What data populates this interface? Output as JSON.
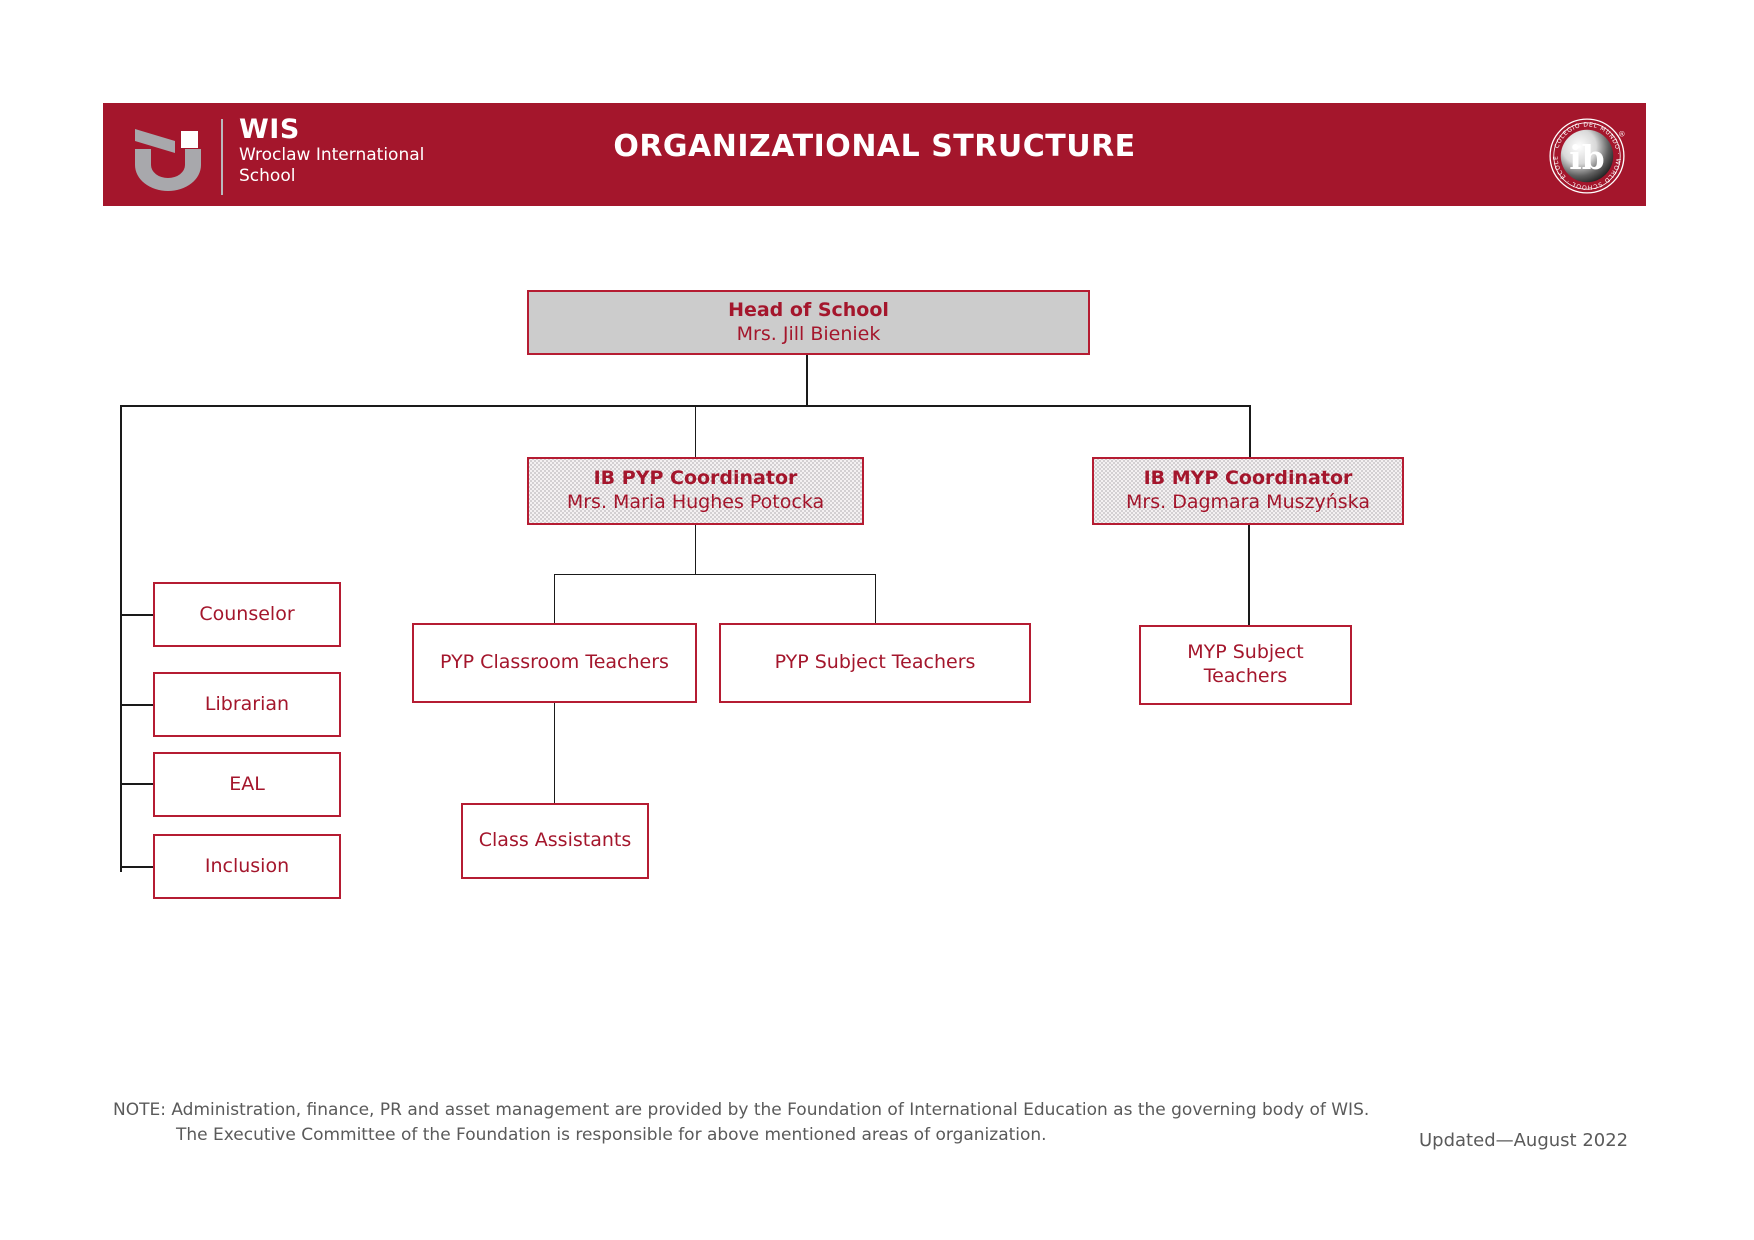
{
  "header": {
    "title": "ORGANIZATIONAL STRUCTURE",
    "brand_abbr": "WIS",
    "brand_line1": "Wroclaw International",
    "brand_line2": "School",
    "brand_mark_icon": "wis-u-mark-icon",
    "accreditation_icon": "ib-world-school-icon",
    "accreditation_center_text": "ib",
    "accreditation_ring_text": "COLEGIO DEL MUNDO · WORLD SCHOOL · ÉCOLE DU MONDE ·",
    "accreditation_registered_mark": "®",
    "bar_color": "#A4162C"
  },
  "chart_colors": {
    "accent_red": "#A4162C",
    "box_border": "#B51C32",
    "head_fill": "#CCCCCC",
    "line": "#1A1A1A",
    "note_text": "#5A5A5A"
  },
  "nodes": {
    "head": {
      "title": "Head of School",
      "person": "Mrs. Jill Bieniek"
    },
    "pyp_coordinator": {
      "title": "IB PYP Coordinator",
      "person": "Mrs. Maria Hughes Potocka"
    },
    "myp_coordinator": {
      "title": "IB MYP Coordinator",
      "person": "Mrs. Dagmara Muszyńska"
    },
    "counselor": {
      "label": "Counselor"
    },
    "librarian": {
      "label": "Librarian"
    },
    "eal": {
      "label": "EAL"
    },
    "inclusion": {
      "label": "Inclusion"
    },
    "pyp_classroom_teachers": {
      "label": "PYP Classroom Teachers"
    },
    "pyp_subject_teachers": {
      "label": "PYP Subject Teachers"
    },
    "myp_subject_teachers": {
      "label": "MYP Subject\nTeachers",
      "line1": "MYP Subject",
      "line2": "Teachers"
    },
    "class_assistants": {
      "label": "Class Assistants"
    }
  },
  "footer": {
    "note_line1": "NOTE: Administration, finance, PR and asset management are provided by the Foundation of International Education as the governing body of WIS.",
    "note_line2": "The Executive Committee of the Foundation is responsible for above mentioned areas of organization.",
    "updated": "Updated—August 2022"
  }
}
